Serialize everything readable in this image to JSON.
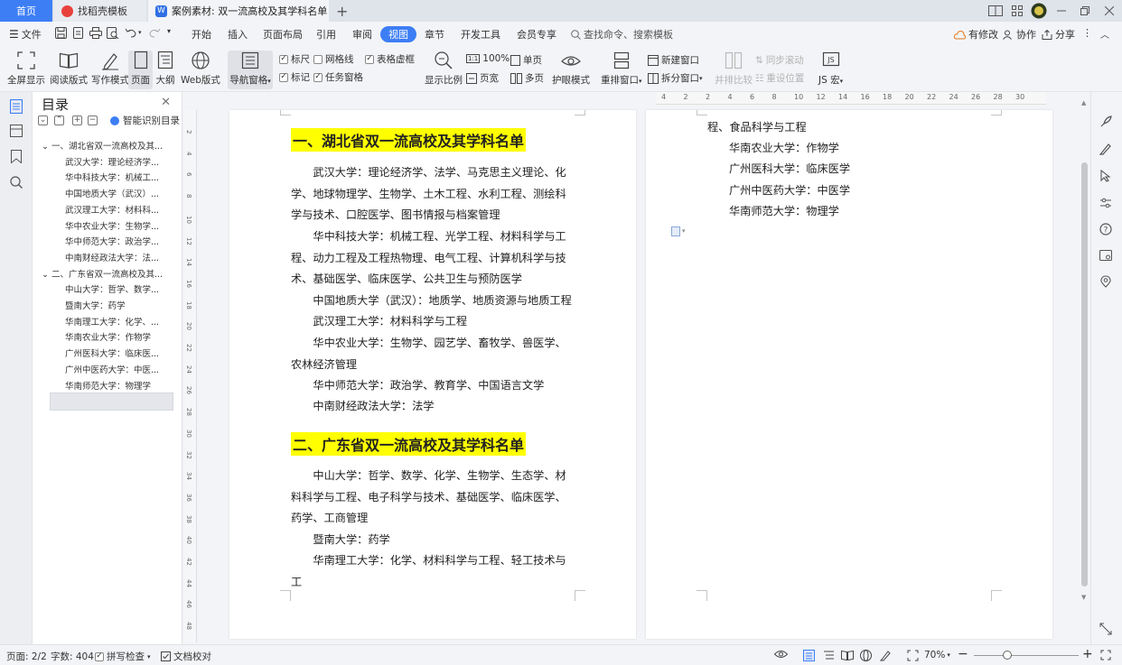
{
  "tabs": {
    "home": "首页",
    "template": "找稻壳模板",
    "document": "案例素材: 双一流高校及其学科名单"
  },
  "menu": {
    "file": "文件",
    "items": [
      "开始",
      "插入",
      "页面布局",
      "引用",
      "审阅",
      "视图",
      "章节",
      "开发工具",
      "会员专享"
    ],
    "active": "视图",
    "search": "查找命令、搜索模板",
    "right": {
      "revise": "有修改",
      "collab": "协作",
      "share": "分享"
    }
  },
  "ribbon": {
    "fullscreen": "全屏显示",
    "reading": "阅读版式",
    "writing": "写作模式",
    "page": "页面",
    "outline": "大纲",
    "web": "Web版式",
    "nav_pane": "导航窗格",
    "ruler": "标尺",
    "gridlines": "网格线",
    "table_gridlines": "表格虚框",
    "marks": "标记",
    "task_pane": "任务窗格",
    "display_ratio": "显示比例",
    "ratio_100": "100%",
    "page_width": "页宽",
    "single_page": "单页",
    "multi_page": "多页",
    "eye_mode": "护眼模式",
    "rearrange": "重排窗口",
    "new_window": "新建窗口",
    "split_window": "拆分窗口",
    "side_by_side": "并排比较",
    "sync_scroll": "同步滚动",
    "reset_pos": "重设位置",
    "js_macro": "JS 宏"
  },
  "checkbox_state": {
    "ruler": true,
    "gridlines": false,
    "table_gridlines": true,
    "marks": true,
    "task_pane": true
  },
  "nav": {
    "title": "目录",
    "smart": "智能识别目录",
    "items": [
      {
        "text": "一、湖北省双一流高校及其...",
        "level": 1
      },
      {
        "text": "武汉大学：理论经济学...",
        "level": 2
      },
      {
        "text": "华中科技大学：机械工...",
        "level": 2
      },
      {
        "text": "中国地质大学（武汉）...",
        "level": 2
      },
      {
        "text": "武汉理工大学：材料科...",
        "level": 2
      },
      {
        "text": "华中农业大学：生物学...",
        "level": 2
      },
      {
        "text": "华中师范大学：政治学...",
        "level": 2
      },
      {
        "text": "中南财经政法大学：法...",
        "level": 2
      },
      {
        "text": "二、广东省双一流高校及其...",
        "level": 1
      },
      {
        "text": "中山大学：哲学、数学...",
        "level": 2
      },
      {
        "text": "暨南大学：药学",
        "level": 2
      },
      {
        "text": "华南理工大学：化学、...",
        "level": 2
      },
      {
        "text": "华南农业大学：作物学",
        "level": 2
      },
      {
        "text": "广州医科大学：临床医...",
        "level": 2
      },
      {
        "text": "广州中医药大学：中医...",
        "level": 2
      },
      {
        "text": "华南师范大学：物理学",
        "level": 2
      }
    ]
  },
  "ruler_marks": [
    "4",
    "2",
    "2",
    "4",
    "6",
    "8",
    "10",
    "12",
    "14",
    "16",
    "18",
    "20",
    "22",
    "24",
    "26",
    "28",
    "30"
  ],
  "vruler_marks": [
    "2",
    "4",
    "6",
    "8",
    "10",
    "12",
    "14",
    "16",
    "18",
    "20",
    "22",
    "24",
    "26",
    "28",
    "30",
    "32",
    "34",
    "36",
    "38",
    "40",
    "42",
    "44",
    "46",
    "48"
  ],
  "doc": {
    "h1": "一、湖北省双一流高校及其学科名单",
    "p1": "武汉大学：理论经济学、法学、马克思主义理论、化学、地球物理学、生物学、土木工程、水利工程、测绘科学与技术、口腔医学、图书情报与档案管理",
    "p2": "华中科技大学：机械工程、光学工程、材料科学与工程、动力工程及工程热物理、电气工程、计算机科学与技术、基础医学、临床医学、公共卫生与预防医学",
    "p3": "中国地质大学（武汉）：地质学、地质资源与地质工程",
    "p4": "武汉理工大学：材料科学与工程",
    "p5": "华中农业大学：生物学、园艺学、畜牧学、兽医学、农林经济管理",
    "p6": "华中师范大学：政治学、教育学、中国语言文学",
    "p7": "中南财经政法大学：法学",
    "h2": "二、广东省双一流高校及其学科名单",
    "p8": "中山大学：哲学、数学、化学、生物学、生态学、材料科学与工程、电子科学与技术、基础医学、临床医学、药学、工商管理",
    "p9": "暨南大学：药学",
    "p10": "华南理工大学：化学、材料科学与工程、轻工技术与工",
    "pg2_l1": "程、食品科学与工程",
    "pg2_l2": "华南农业大学：作物学",
    "pg2_l3": "广州医科大学：临床医学",
    "pg2_l4": "广州中医药大学：中医学",
    "pg2_l5": "华南师范大学：物理学"
  },
  "status": {
    "page": "页面: 2/2",
    "words": "字数: 404",
    "spell": "拼写检查",
    "proof": "文档校对",
    "zoom": "70%"
  }
}
